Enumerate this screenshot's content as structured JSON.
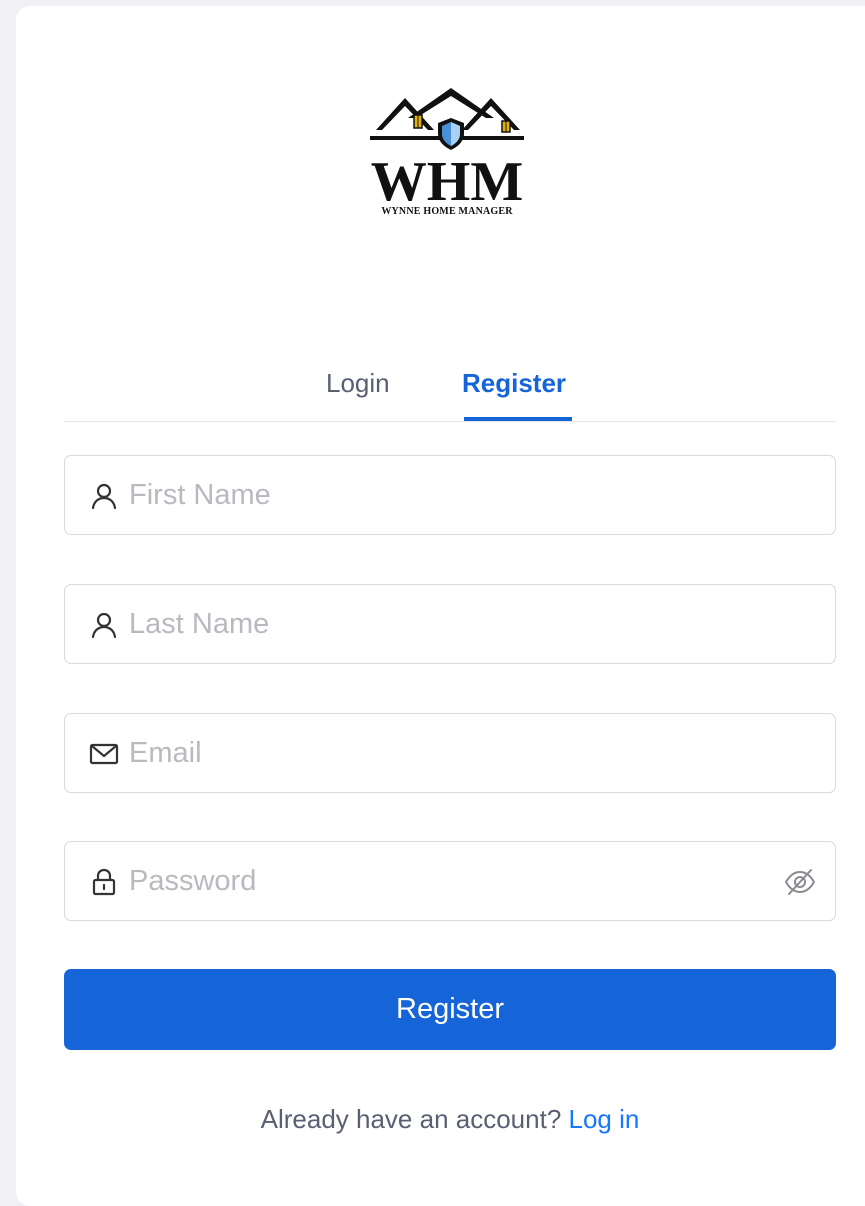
{
  "brand": {
    "logo_text": "WHM",
    "tagline": "WYNNE HOME MANAGER"
  },
  "tabs": [
    {
      "label": "Login",
      "active": false
    },
    {
      "label": "Register",
      "active": true
    }
  ],
  "form": {
    "first_name": {
      "placeholder": "First Name",
      "value": "",
      "icon": "user-icon"
    },
    "last_name": {
      "placeholder": "Last Name",
      "value": "",
      "icon": "user-icon"
    },
    "email": {
      "placeholder": "Email",
      "value": "",
      "icon": "mail-icon"
    },
    "password": {
      "placeholder": "Password",
      "value": "",
      "icon": "lock-icon",
      "toggle_icon": "eye-invisible-icon"
    }
  },
  "submit_label": "Register",
  "footer": {
    "prompt": "Already have an account?",
    "link_label": "Log in"
  },
  "colors": {
    "accent": "#1564d8",
    "link": "#1677ff",
    "logo_shield": "#4a90d9",
    "logo_window": "#e2b40a"
  }
}
